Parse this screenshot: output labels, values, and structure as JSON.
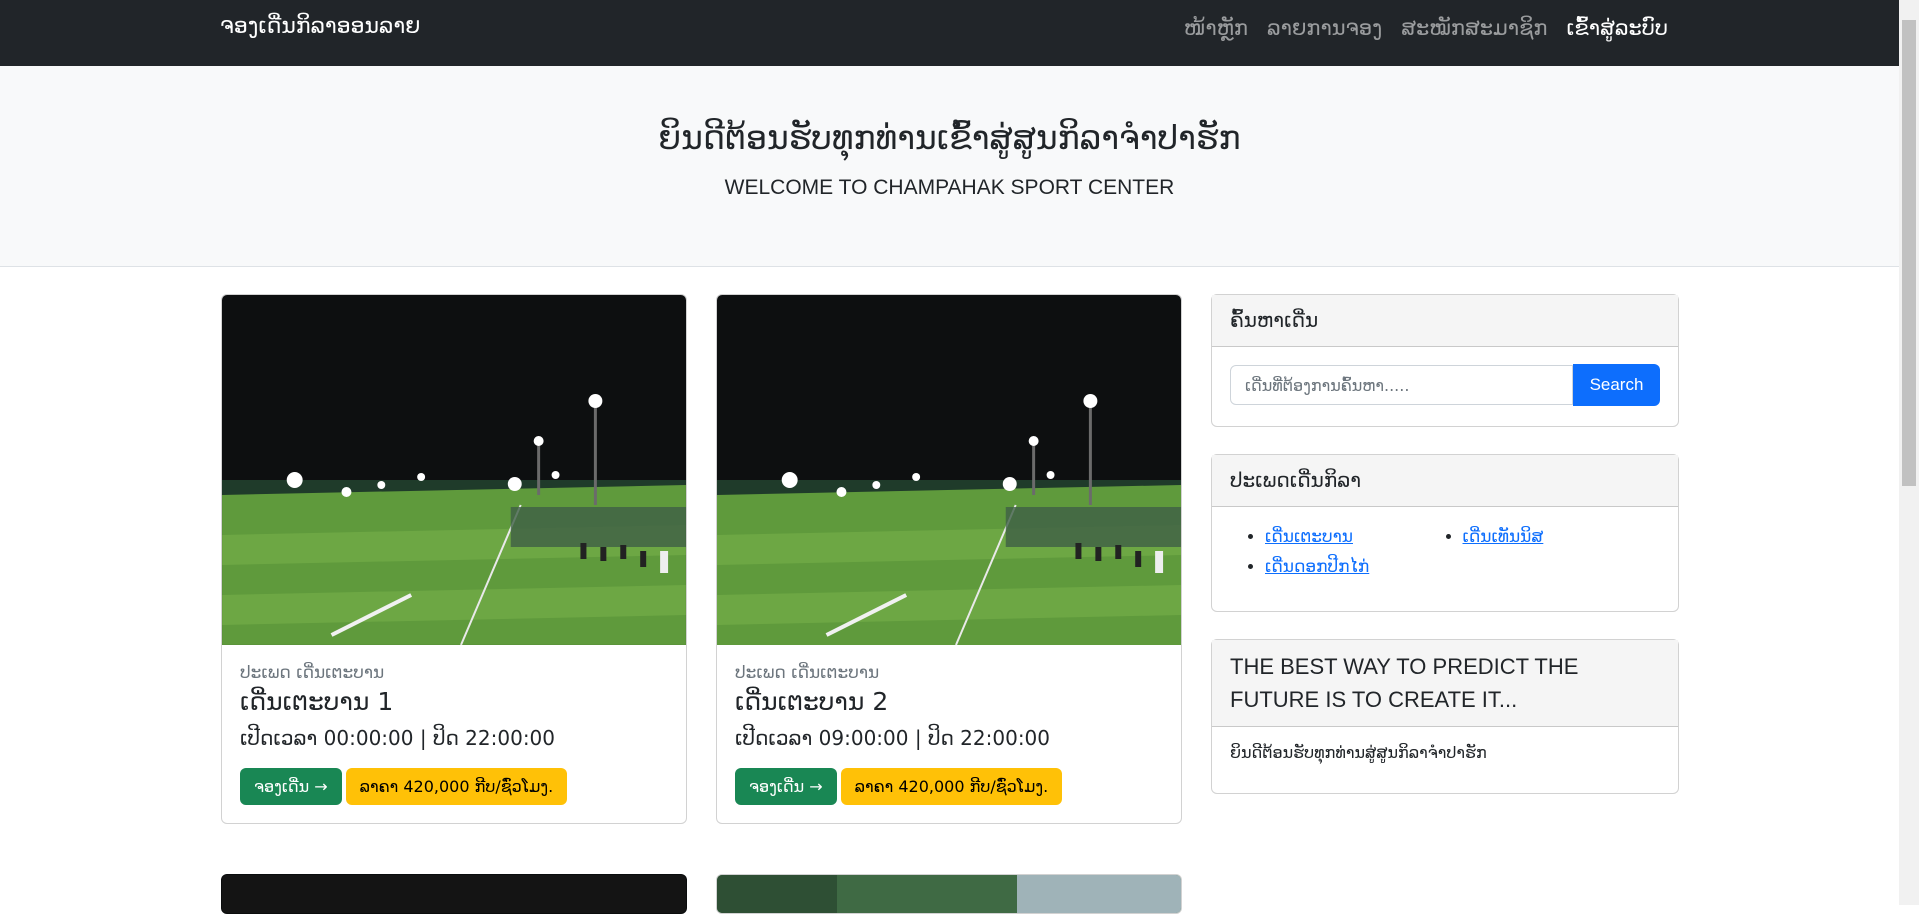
{
  "navbar": {
    "brand": "ຈອງເດີ່ນກິລາອອນລາຍ",
    "links": [
      "ໜ້າຫຼັກ",
      "ລາຍການຈອງ",
      "ສະໝັກສະມາຊິກ",
      "ເຂົ້າສູ່ລະບົບ"
    ]
  },
  "header": {
    "title_lao": "ຍິນດີຕ້ອນຮັບທຸກທ່ານເຂົ້າສູ່ສູນກິລາຈຳປາຮັກ",
    "subtitle": "WELCOME TO CHAMPAHAK SPORT CENTER"
  },
  "cards": [
    {
      "category": "ປະເພດ ເດີ່ນເຕະບານ",
      "title": "ເດີ່ນເຕະບານ 1",
      "hours": "ເປີດເວລາ 00:00:00 | ປິດ 22:00:00",
      "book_label": "ຈອງເດີ່ນ →",
      "price_label": "ລາຄາ 420,000 ກີບ/ຊົ່ວໂມງ."
    },
    {
      "category": "ປະເພດ ເດີ່ນເຕະບານ",
      "title": "ເດີ່ນເຕະບານ 2",
      "hours": "ເປີດເວລາ 09:00:00 | ປິດ 22:00:00",
      "book_label": "ຈອງເດີ່ນ →",
      "price_label": "ລາຄາ 420,000 ກີບ/ຊົ່ວໂມງ."
    }
  ],
  "sidebar": {
    "search": {
      "heading": "ຄົ້ນຫາເດີ່ນ",
      "placeholder": "ເດີ່ນທີ່ຕ້ອງການຄົ້ນຫາ.....",
      "button": "Search"
    },
    "categories": {
      "heading": "ປະເພດເດີ່ນກິລາ",
      "items": [
        "ເດີ່ນເຕະບານ",
        "ເດີ່ນເທັນນິສ",
        "ເດີ່ນດອກປີກໄກ່"
      ]
    },
    "quote": {
      "heading": "THE BEST WAY TO PREDICT THE FUTURE IS TO CREATE IT...",
      "body": "ຍິນດີຕ້ອນຮັບທຸກທ່ານສູ່ສູນກິລາຈຳປາຮັກ"
    }
  }
}
